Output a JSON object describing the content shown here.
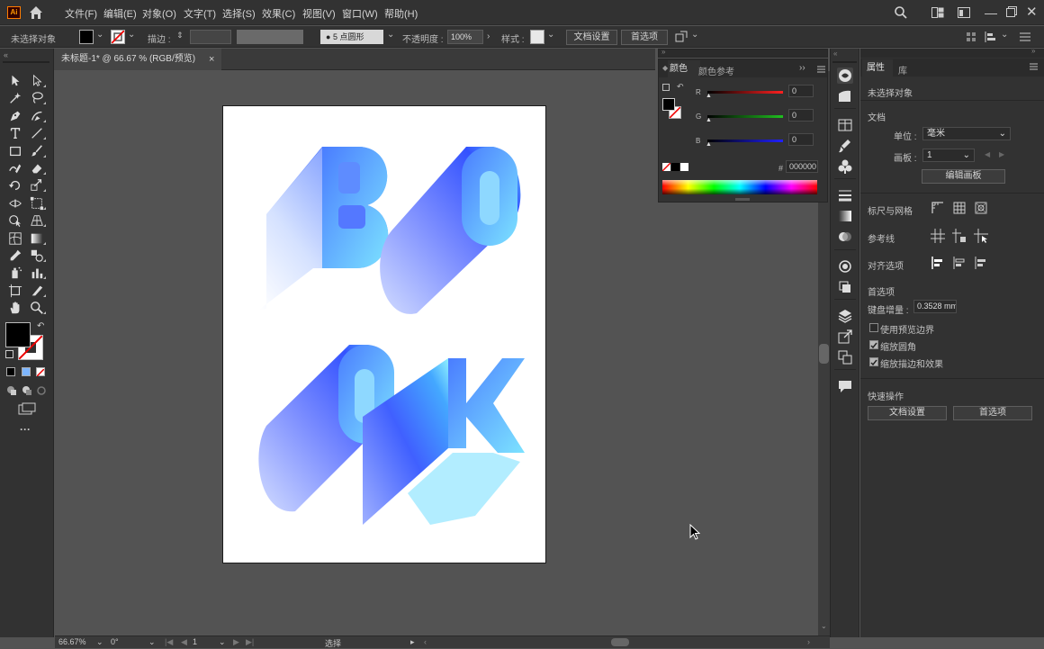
{
  "app": {
    "logo": "Ai"
  },
  "menu": [
    "文件(F)",
    "编辑(E)",
    "对象(O)",
    "文字(T)",
    "选择(S)",
    "效果(C)",
    "视图(V)",
    "窗口(W)",
    "帮助(H)"
  ],
  "control_bar": {
    "no_selection": "未选择对象",
    "stroke_label": "描边 :",
    "brush_label": "5 点圆形",
    "opacity_label": "不透明度 :",
    "opacity_value": "100%",
    "style_label": "样式 :",
    "doc_setup_button": "文档设置",
    "preferences_button": "首选项"
  },
  "document_tab": {
    "title": "未标题-1* @ 66.67 % (RGB/预览)",
    "close": "×"
  },
  "color_panel": {
    "tab_color": "颜色",
    "tab_color_guide": "颜色参考",
    "channels": [
      {
        "label": "R",
        "value": "0",
        "color": "#ff2020"
      },
      {
        "label": "G",
        "value": "0",
        "color": "#20c020"
      },
      {
        "label": "B",
        "value": "0",
        "color": "#2020ff"
      }
    ],
    "hex_label": "#",
    "hex_value": "000000"
  },
  "properties_panel": {
    "tab_properties": "属性",
    "tab_library": "库",
    "no_selection": "未选择对象",
    "document_section": "文档",
    "units_label": "单位 :",
    "units_value": "毫米",
    "artboard_label": "画板 :",
    "artboard_value": "1",
    "edit_artboards_button": "编辑画板",
    "rulers_grids": "标尺与网格",
    "guides": "参考线",
    "align_options": "对齐选项",
    "preferences": "首选项",
    "keyboard_increment_label": "键盘增量 :",
    "keyboard_increment_value": "0.3528 mm",
    "checkboxes": [
      {
        "label": "使用预览边界",
        "checked": false
      },
      {
        "label": "缩放圆角",
        "checked": true
      },
      {
        "label": "缩放描边和效果",
        "checked": true
      }
    ],
    "quick_actions": "快速操作",
    "doc_setup_button": "文档设置",
    "preferences_button": "首选项"
  },
  "status_bar": {
    "zoom": "66.67%",
    "rotation": "0°",
    "artboard_nav": "1",
    "tool_name": "选择"
  },
  "artwork": {
    "letters": [
      "B",
      "O",
      "O",
      "K"
    ],
    "gradient_start": "#2b5cff",
    "gradient_end": "#7ee8ff"
  }
}
